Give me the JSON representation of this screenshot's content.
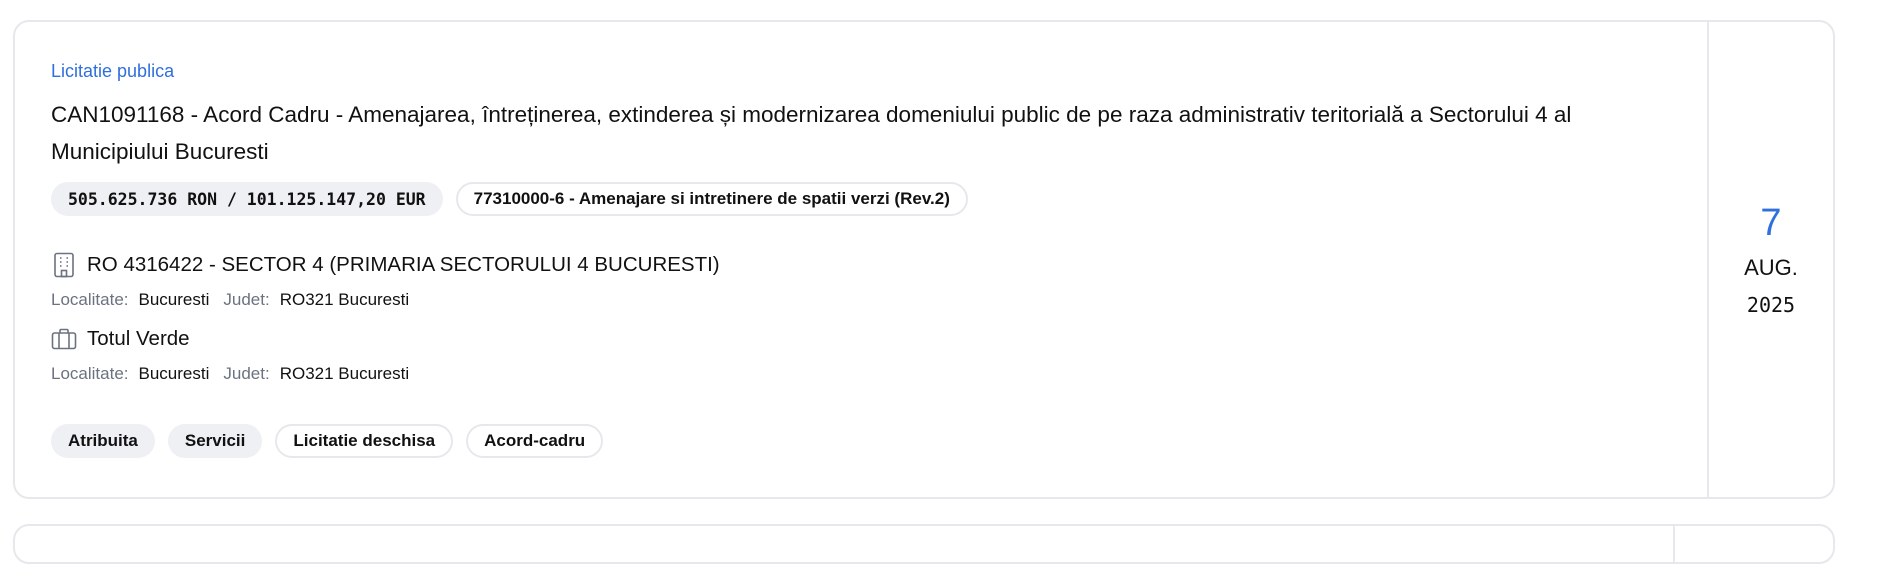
{
  "listing": {
    "procedure_type": "Licitatie publica",
    "title": "CAN1091168 - Acord Cadru - Amenajarea, întreținerea, extinderea și modernizarea domeniului public de pe raza administrativ teritorială a Sectorului 4 al Municipiului Bucuresti",
    "value": "505.625.736 RON / 101.125.147,20 EUR",
    "cpv": "77310000-6 - Amenajare si intretinere de spatii verzi (Rev.2)",
    "buyer": {
      "icon": "building-icon",
      "name": "RO 4316422 - SECTOR 4 (PRIMARIA SECTORULUI 4 BUCURESTI)",
      "locality_label": "Localitate:",
      "locality": "Bucuresti",
      "county_label": "Judet:",
      "county": "RO321 Bucuresti"
    },
    "winner": {
      "icon": "briefcase-icon",
      "name": "Totul Verde",
      "locality_label": "Localitate:",
      "locality": "Bucuresti",
      "county_label": "Judet:",
      "county": "RO321 Bucuresti"
    },
    "statuses": [
      {
        "label": "Atribuita",
        "style": "filled"
      },
      {
        "label": "Servicii",
        "style": "filled"
      },
      {
        "label": "Licitatie deschisa",
        "style": "outlined"
      },
      {
        "label": "Acord-cadru",
        "style": "outlined"
      }
    ],
    "date": {
      "day": "7",
      "month": "AUG.",
      "year": "2025"
    }
  },
  "colors": {
    "accent": "#2f6fde",
    "border": "#e6e8ec",
    "chip_background": "#eef0f3",
    "muted_text": "#6b7280"
  }
}
